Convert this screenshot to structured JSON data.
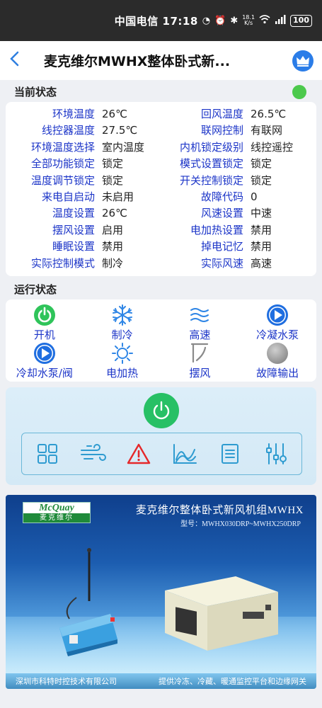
{
  "statusbar": {
    "carrier_time": "中国电信 17:18",
    "net_speed_top": "18.1",
    "net_speed_bottom": "K/s",
    "battery": "100"
  },
  "header": {
    "title": "麦克维尔MWHX整体卧式新..."
  },
  "current_status": {
    "title": "当前状态",
    "online_color": "#4cc94c",
    "rows": [
      {
        "l1": "环境温度",
        "v1": "26℃",
        "l2": "回风温度",
        "v2": "26.5℃"
      },
      {
        "l1": "线控器温度",
        "v1": "27.5℃",
        "l2": "联网控制",
        "v2": "有联网"
      },
      {
        "l1": "环境温度选择",
        "v1": "室内温度",
        "l2": "内机锁定级别",
        "v2": "线控遥控"
      },
      {
        "l1": "全部功能锁定",
        "v1": "锁定",
        "l2": "模式设置锁定",
        "v2": "锁定"
      },
      {
        "l1": "温度调节锁定",
        "v1": "锁定",
        "l2": "开关控制锁定",
        "v2": "锁定"
      },
      {
        "l1": "来电自启动",
        "v1": "未启用",
        "l2": "故障代码",
        "v2": "0"
      },
      {
        "l1": "温度设置",
        "v1": "26℃",
        "l2": "风速设置",
        "v2": "中速"
      },
      {
        "l1": "摆风设置",
        "v1": "启用",
        "l2": "电加热设置",
        "v2": "禁用"
      },
      {
        "l1": "睡眠设置",
        "v1": "禁用",
        "l2": "掉电记忆",
        "v2": "禁用"
      },
      {
        "l1": "实际控制模式",
        "v1": "制冷",
        "l2": "实际风速",
        "v2": "高速"
      }
    ]
  },
  "run_status": {
    "title": "运行状态",
    "items": [
      {
        "label": "开机",
        "icon": "power-on-icon"
      },
      {
        "label": "制冷",
        "icon": "snowflake-icon"
      },
      {
        "label": "高速",
        "icon": "wind-waves-icon"
      },
      {
        "label": "冷凝水泵",
        "icon": "play-circle-icon"
      },
      {
        "label": "冷却水泵/阀",
        "icon": "play-circle-icon"
      },
      {
        "label": "电加热",
        "icon": "sun-icon"
      },
      {
        "label": "摆风",
        "icon": "swing-icon"
      },
      {
        "label": "故障输出",
        "icon": "gray-dot-icon"
      }
    ]
  },
  "controls": {
    "tools": [
      "grid-icon",
      "wind-icon",
      "warning-icon",
      "trend-chart-icon",
      "list-icon",
      "settings-sliders-icon"
    ]
  },
  "banner": {
    "brand_en": "McQuay",
    "brand_cn": "麦克维尔",
    "title": "麦克维尔整体卧式新风机组MWHX",
    "model": "型号：MWHX030DRP~MWHX250DRP",
    "footer_left": "深圳市科特时控技术有限公司",
    "footer_right": "提供冷冻、冷藏、暖通监控平台和边缘网关"
  },
  "colors": {
    "label_blue": "#1c35c8",
    "accent_blue": "#2b7de8",
    "power_green": "#27c065"
  }
}
